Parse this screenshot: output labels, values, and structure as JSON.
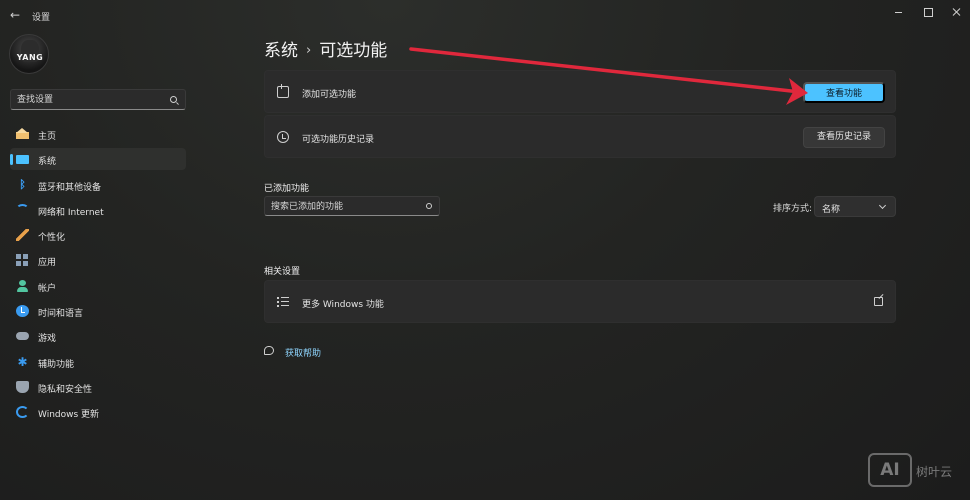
{
  "window": {
    "title": "设置",
    "back_glyph": "←"
  },
  "profile": {
    "avatar_text": "YANG"
  },
  "search": {
    "placeholder": "查找设置"
  },
  "sidebar": {
    "items": [
      {
        "label": "主页",
        "icon": "home-icon"
      },
      {
        "label": "系统",
        "icon": "system-icon",
        "active": true
      },
      {
        "label": "蓝牙和其他设备",
        "icon": "bluetooth-icon"
      },
      {
        "label": "网络和 Internet",
        "icon": "wifi-icon"
      },
      {
        "label": "个性化",
        "icon": "brush-icon"
      },
      {
        "label": "应用",
        "icon": "apps-icon"
      },
      {
        "label": "帐户",
        "icon": "user-icon"
      },
      {
        "label": "时间和语言",
        "icon": "clock-globe-icon"
      },
      {
        "label": "游戏",
        "icon": "gamepad-icon"
      },
      {
        "label": "辅助功能",
        "icon": "accessibility-icon"
      },
      {
        "label": "隐私和安全性",
        "icon": "shield-icon"
      },
      {
        "label": "Windows 更新",
        "icon": "update-icon"
      }
    ]
  },
  "breadcrumb": {
    "parent": "系统",
    "separator": "›",
    "current": "可选功能"
  },
  "cards": {
    "add_feature": {
      "label": "添加可选功能",
      "button": "查看功能",
      "icon": "add-grid-icon"
    },
    "history": {
      "label": "可选功能历史记录",
      "button": "查看历史记录",
      "icon": "history-icon"
    }
  },
  "added_features": {
    "title": "已添加功能",
    "search_placeholder": "搜索已添加的功能",
    "sort_label": "排序方式:",
    "sort_value": "名称"
  },
  "related": {
    "title": "相关设置",
    "more_windows_features": "更多 Windows 功能"
  },
  "help": {
    "label": "获取帮助"
  },
  "watermark": {
    "badge": "AI",
    "text": "树叶云"
  },
  "colors": {
    "accent": "#4cc2ff",
    "annotation_arrow": "#e0283c",
    "background": "#202020",
    "card": "#2b2b2b"
  }
}
